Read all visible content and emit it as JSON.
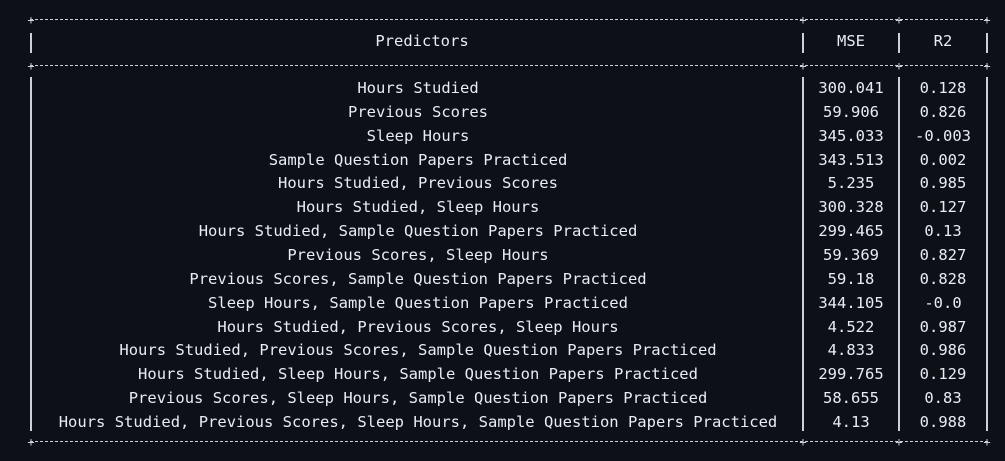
{
  "table": {
    "headers": {
      "predictors": "Predictors",
      "mse": "MSE",
      "r2": "R2"
    },
    "rows": [
      {
        "predictors": "Hours Studied",
        "mse": "300.041",
        "r2": "0.128"
      },
      {
        "predictors": "Previous Scores",
        "mse": "59.906",
        "r2": "0.826"
      },
      {
        "predictors": "Sleep Hours",
        "mse": "345.033",
        "r2": "-0.003"
      },
      {
        "predictors": "Sample Question Papers Practiced",
        "mse": "343.513",
        "r2": "0.002"
      },
      {
        "predictors": "Hours Studied, Previous Scores",
        "mse": "5.235",
        "r2": "0.985"
      },
      {
        "predictors": "Hours Studied, Sleep Hours",
        "mse": "300.328",
        "r2": "0.127"
      },
      {
        "predictors": "Hours Studied, Sample Question Papers Practiced",
        "mse": "299.465",
        "r2": "0.13"
      },
      {
        "predictors": "Previous Scores, Sleep Hours",
        "mse": "59.369",
        "r2": "0.827"
      },
      {
        "predictors": "Previous Scores, Sample Question Papers Practiced",
        "mse": "59.18",
        "r2": "0.828"
      },
      {
        "predictors": "Sleep Hours, Sample Question Papers Practiced",
        "mse": "344.105",
        "r2": "-0.0"
      },
      {
        "predictors": "Hours Studied, Previous Scores, Sleep Hours",
        "mse": "4.522",
        "r2": "0.987"
      },
      {
        "predictors": "Hours Studied, Previous Scores, Sample Question Papers Practiced",
        "mse": "4.833",
        "r2": "0.986"
      },
      {
        "predictors": "Hours Studied, Sleep Hours, Sample Question Papers Practiced",
        "mse": "299.765",
        "r2": "0.129"
      },
      {
        "predictors": "Previous Scores, Sleep Hours, Sample Question Papers Practiced",
        "mse": "58.655",
        "r2": "0.83"
      },
      {
        "predictors": "Hours Studied, Previous Scores, Sleep Hours, Sample Question Papers Practiced",
        "mse": "4.13",
        "r2": "0.988"
      }
    ]
  }
}
